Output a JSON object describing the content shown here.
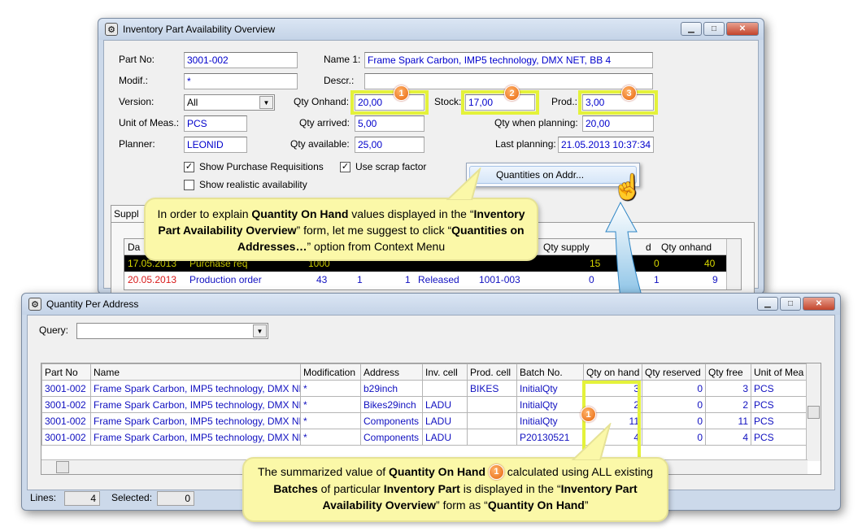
{
  "win1": {
    "title": "Inventory Part Availability Overview",
    "labels": {
      "part_no": "Part No:",
      "name1": "Name 1:",
      "modif": "Modif.:",
      "descr": "Descr.:",
      "version": "Version:",
      "qty_onhand": "Qty Onhand:",
      "stock": "Stock:",
      "prod": "Prod.:",
      "uom": "Unit of Meas.:",
      "qty_arrived": "Qty arrived:",
      "qty_planning": "Qty when planning:",
      "planner": "Planner:",
      "qty_available": "Qty available:",
      "last_planning": "Last planning:"
    },
    "values": {
      "part_no": "3001-002",
      "name1": "Frame Spark Carbon, IMP5 technology, DMX NET, BB 4",
      "modif": "*",
      "descr": "",
      "version": "All",
      "qty_onhand": "20,00",
      "stock": "17,00",
      "prod": "3,00",
      "uom": "PCS",
      "qty_arrived": "5,00",
      "qty_planning": "20,00",
      "planner": "LEONID",
      "qty_available": "25,00",
      "last_planning": "21.05.2013 10:37:34"
    },
    "checkboxes": {
      "show_pr": "Show Purchase Requisitions",
      "show_pr_checked": "✓",
      "scrap": "Use scrap factor",
      "scrap_checked": "✓",
      "realistic": "Show realistic availability",
      "realistic_checked": ""
    },
    "tab_label": "Suppl",
    "context_menu": "Quantities on Addr...",
    "grid": {
      "headers": [
        "Da",
        "Qty supply",
        "d",
        "Qty onhand"
      ],
      "row1": {
        "date": "17.05.2013",
        "type": "Purchase req",
        "qty": "1000",
        "supply": "15",
        "d": "0",
        "onhand": "40"
      },
      "row2": {
        "date": "20.05.2013",
        "type": "Production order",
        "qty": "43",
        "c1": "1",
        "c2": "1",
        "status": "Released",
        "part": "1001-003",
        "supply": "0",
        "d": "1",
        "onhand": "9"
      }
    }
  },
  "badges": {
    "b1": "1",
    "b2": "2",
    "b3": "3",
    "b4": "1",
    "b5": "1"
  },
  "callout1": {
    "p1": "In order to explain ",
    "b1": "Quantity On Hand",
    "p2": " values displayed in the “",
    "b2": "Inventory Part Availability Overview",
    "p3": "” form, let me suggest to click “",
    "b3": "Quantities on Addresses…",
    "p4": "” option from Context Menu"
  },
  "win2": {
    "title": "Quantity Per Address",
    "query_label": "Query:",
    "query_value": "",
    "headers": [
      "Part No",
      "Name",
      "Modification",
      "Address",
      "Inv. cell",
      "Prod. cell",
      "Batch No.",
      "Qty on hand",
      "Qty reserved",
      "Qty free",
      "Unit of Mea"
    ],
    "rows": [
      [
        "3001-002",
        "Frame Spark Carbon, IMP5 technology, DMX NET",
        "*",
        "b29inch",
        "",
        "BIKES",
        "InitialQty",
        "3",
        "0",
        "3",
        "PCS"
      ],
      [
        "3001-002",
        "Frame Spark Carbon, IMP5 technology, DMX NET",
        "*",
        "Bikes29inch",
        "LADU",
        "",
        "InitialQty",
        "2",
        "0",
        "2",
        "PCS"
      ],
      [
        "3001-002",
        "Frame Spark Carbon, IMP5 technology, DMX NET",
        "*",
        "Components",
        "LADU",
        "",
        "InitialQty",
        "11",
        "0",
        "11",
        "PCS"
      ],
      [
        "3001-002",
        "Frame Spark Carbon, IMP5 technology, DMX NET",
        "*",
        "Components",
        "LADU",
        "",
        "P20130521",
        "4",
        "0",
        "4",
        "PCS"
      ]
    ],
    "status": {
      "lines_label": "Lines:",
      "lines": "4",
      "selected_label": "Selected:",
      "selected": "0"
    }
  },
  "callout2": {
    "p1": "The summarized value of ",
    "b1": "Quantity On Hand",
    "p2": " calculated using ALL existing ",
    "b2": "Batches",
    "p3": " of particular ",
    "b3": "Inventory Part",
    "p4": " is displayed in the “",
    "b4": "Inventory Part Availability Overview",
    "p5": "” form as “",
    "b5": "Quantity On Hand",
    "p6": "”"
  },
  "colors": {
    "highlight": "#e4f23a",
    "badge": "#e8650b",
    "callout": "#fbf8a8",
    "blue_text": "#1010c0"
  }
}
